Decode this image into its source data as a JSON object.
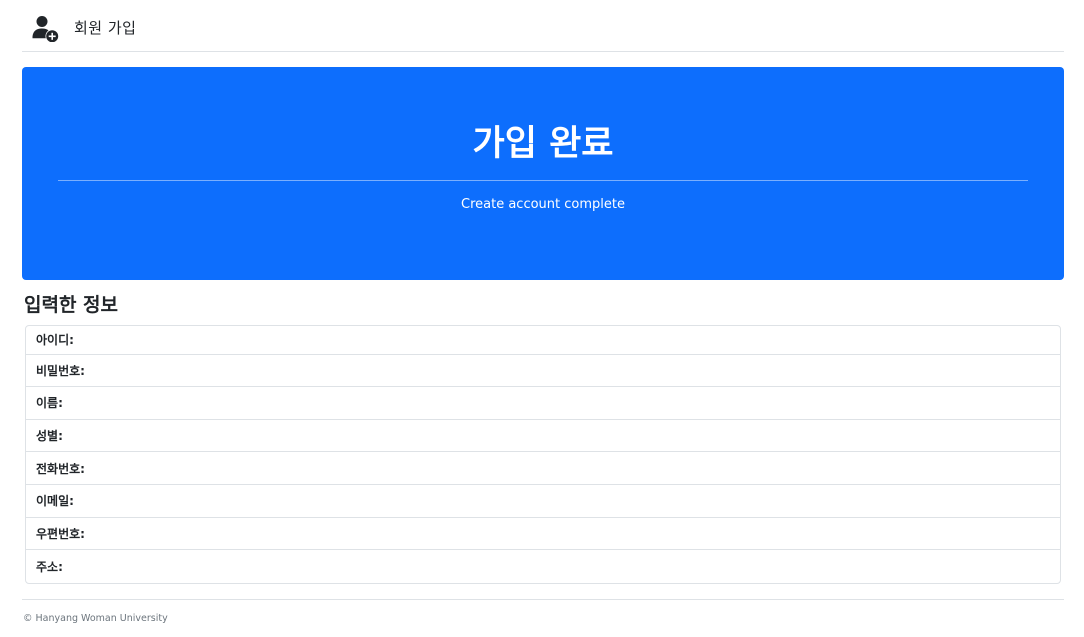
{
  "header": {
    "icon": "user-plus-icon",
    "title": "회원 가입"
  },
  "hero": {
    "title": "가입 완료",
    "subtitle": "Create account complete",
    "background_color": "#0d6efd"
  },
  "info": {
    "title": "입력한 정보",
    "fields": [
      {
        "label": "아이디:"
      },
      {
        "label": "비밀번호:"
      },
      {
        "label": "이름:"
      },
      {
        "label": "성별:"
      },
      {
        "label": "전화번호:"
      },
      {
        "label": "이메일:"
      },
      {
        "label": "우편번호:"
      },
      {
        "label": "주소:"
      }
    ]
  },
  "footer": {
    "text": "© Hanyang Woman University"
  }
}
